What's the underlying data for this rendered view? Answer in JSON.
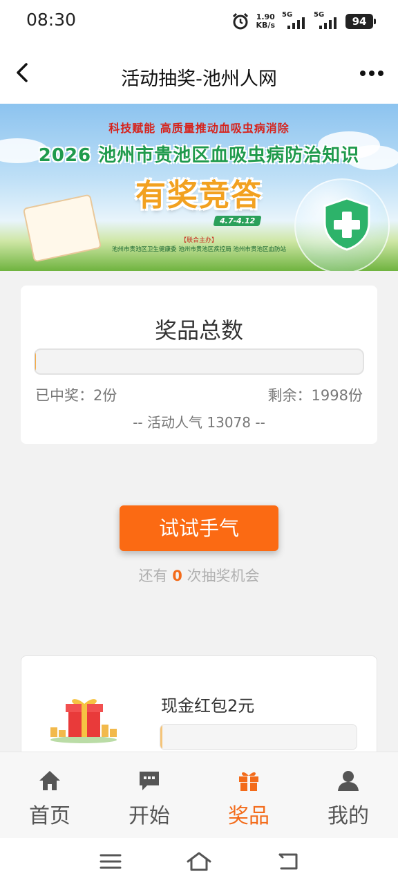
{
  "status_bar": {
    "time": "08:30",
    "net_speed_value": "1.90",
    "net_speed_unit": "KB/s",
    "signal1_label": "5G",
    "signal2_label": "5G",
    "battery": "94"
  },
  "header": {
    "title": "活动抽奖-池州人网"
  },
  "banner": {
    "slogan": "科技赋能 高质量推动血吸虫病消除",
    "headline": "2026 池州市贵池区血吸虫病防治知识",
    "main_title": "有奖竞答",
    "dates": "4.7-4.12",
    "joint_label": "【联合主办】",
    "organizers": "池州市贵池区卫生健康委   池州市贵池区疾控局   池州市贵池区血防站"
  },
  "prize_summary": {
    "title": "奖品总数",
    "won_text": "已中奖：2份",
    "remaining_text": "剩余：1998份",
    "popularity_text": "-- 活动人气  13078 --",
    "progress_fraction": 0.001
  },
  "lottery": {
    "button_label": "试试手气",
    "chances_prefix": "还有 ",
    "chances_count": "0",
    "chances_suffix": " 次抽奖机会"
  },
  "prize_item": {
    "name": "现金红包2元",
    "progress_fraction": 0.01
  },
  "tabs": [
    {
      "label": "首页",
      "icon": "home-icon",
      "active": false
    },
    {
      "label": "开始",
      "icon": "chat-icon",
      "active": false
    },
    {
      "label": "奖品",
      "icon": "gift-icon",
      "active": true
    },
    {
      "label": "我的",
      "icon": "user-icon",
      "active": false
    }
  ],
  "colors": {
    "accent": "#fb6a13",
    "active_tab": "#f36b1a",
    "progress": "#f5a73c"
  }
}
